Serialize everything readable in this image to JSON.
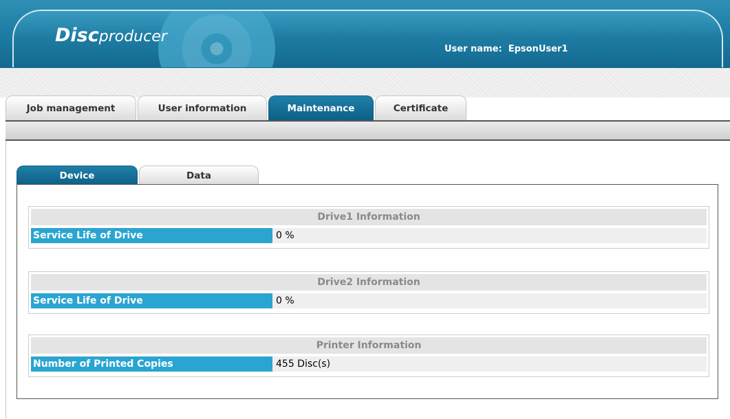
{
  "header": {
    "logo_bold": "Disc",
    "logo_light": "producer",
    "user_label": "User name:",
    "user_name": "EpsonUser1"
  },
  "top_tabs": [
    {
      "label": "Job management",
      "active": false
    },
    {
      "label": "User information",
      "active": false
    },
    {
      "label": "Maintenance",
      "active": true
    },
    {
      "label": "Certificate",
      "active": false
    }
  ],
  "inner_tabs": [
    {
      "label": "Device",
      "active": true
    },
    {
      "label": "Data",
      "active": false
    }
  ],
  "panels": [
    {
      "title": "Drive1 Information",
      "label": "Service Life of Drive",
      "value": "0 %"
    },
    {
      "title": "Drive2 Information",
      "label": "Service Life of Drive",
      "value": "0 %"
    },
    {
      "title": "Printer Information",
      "label": "Number of Printed Copies",
      "value": "455 Disc(s)"
    }
  ],
  "colors": {
    "header_blue": "#1f7ea5",
    "active_tab": "#1f80a9",
    "label_blue": "#2aa5d1"
  }
}
